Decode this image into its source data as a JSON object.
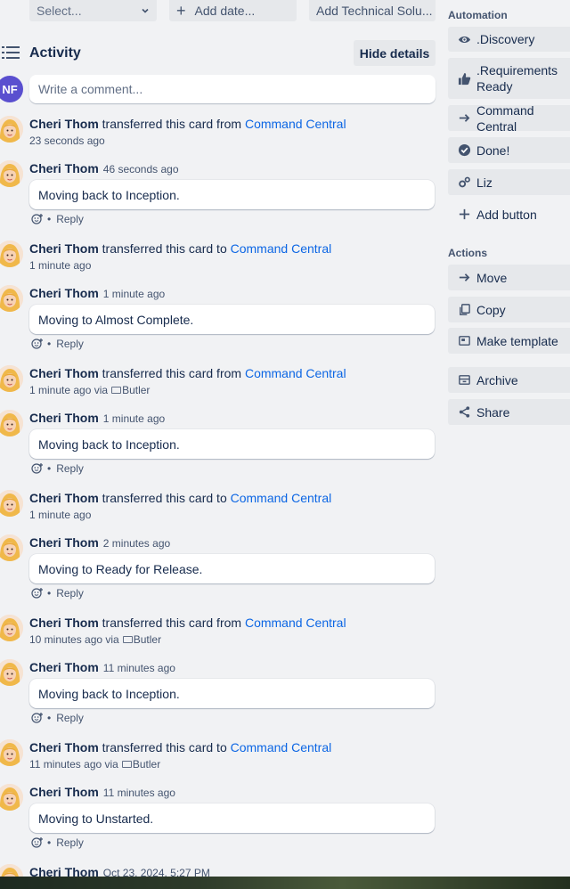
{
  "top_actions": {
    "select_placeholder": "Select...",
    "add_date": "Add date...",
    "add_technical": "Add Technical Solu..."
  },
  "activity": {
    "title": "Activity",
    "hide_details": "Hide details",
    "comment_placeholder": "Write a comment...",
    "me_initials": "NF"
  },
  "feed": [
    {
      "type": "transfer",
      "user": "Cheri Thom",
      "action": "transferred this card from",
      "board": "Command Central",
      "time": "23 seconds ago",
      "via": ""
    },
    {
      "type": "comment",
      "user": "Cheri Thom",
      "time": "46 seconds ago",
      "text": "Moving back to Inception.",
      "reply": "Reply"
    },
    {
      "type": "transfer",
      "user": "Cheri Thom",
      "action": "transferred this card to",
      "board": "Command Central",
      "time": "1 minute ago",
      "via": ""
    },
    {
      "type": "comment",
      "user": "Cheri Thom",
      "time": "1 minute ago",
      "text": "Moving to Almost Complete.",
      "reply": "Reply"
    },
    {
      "type": "transfer",
      "user": "Cheri Thom",
      "action": "transferred this card from",
      "board": "Command Central",
      "time": "1 minute ago via",
      "via": "Butler"
    },
    {
      "type": "comment",
      "user": "Cheri Thom",
      "time": "1 minute ago",
      "text": "Moving back to Inception.",
      "reply": "Reply"
    },
    {
      "type": "transfer",
      "user": "Cheri Thom",
      "action": "transferred this card to",
      "board": "Command Central",
      "time": "1 minute ago",
      "via": ""
    },
    {
      "type": "comment",
      "user": "Cheri Thom",
      "time": "2 minutes ago",
      "text": "Moving to Ready for Release.",
      "reply": "Reply"
    },
    {
      "type": "transfer",
      "user": "Cheri Thom",
      "action": "transferred this card from",
      "board": "Command Central",
      "time": "10 minutes ago via",
      "via": "Butler"
    },
    {
      "type": "comment",
      "user": "Cheri Thom",
      "time": "11 minutes ago",
      "text": "Moving back to Inception.",
      "reply": "Reply"
    },
    {
      "type": "transfer",
      "user": "Cheri Thom",
      "action": "transferred this card to",
      "board": "Command Central",
      "time": "11 minutes ago via",
      "via": "Butler"
    },
    {
      "type": "comment",
      "user": "Cheri Thom",
      "time": "11 minutes ago",
      "text": "Moving to Unstarted.",
      "reply": "Reply"
    },
    {
      "type": "header",
      "user": "Cheri Thom",
      "time": "Oct 23, 2024, 5:27 PM"
    }
  ],
  "sidebar": {
    "automation_label": "Automation",
    "automation": [
      {
        "label": ".Discovery",
        "icon": "eye-icon"
      },
      {
        "label": ".Requirements Ready",
        "icon": "thumbs-up-icon"
      },
      {
        "label": "Command Central",
        "icon": "arrow-right-icon"
      },
      {
        "label": "Done!",
        "icon": "check-circle-icon"
      },
      {
        "label": "Liz",
        "icon": "gears-icon"
      }
    ],
    "add_button": "Add button",
    "actions_label": "Actions",
    "actions": [
      {
        "label": "Move",
        "icon": "arrow-right-icon"
      },
      {
        "label": "Copy",
        "icon": "copy-icon"
      },
      {
        "label": "Make template",
        "icon": "template-icon"
      },
      {
        "label": "Archive",
        "icon": "archive-icon"
      },
      {
        "label": "Share",
        "icon": "share-icon"
      }
    ]
  },
  "colors": {
    "link": "#0c66e4",
    "avatar_nf": "#5a4fcf",
    "panel_bg": "#f1f2f4",
    "button_bg": "#e6e8eb"
  }
}
